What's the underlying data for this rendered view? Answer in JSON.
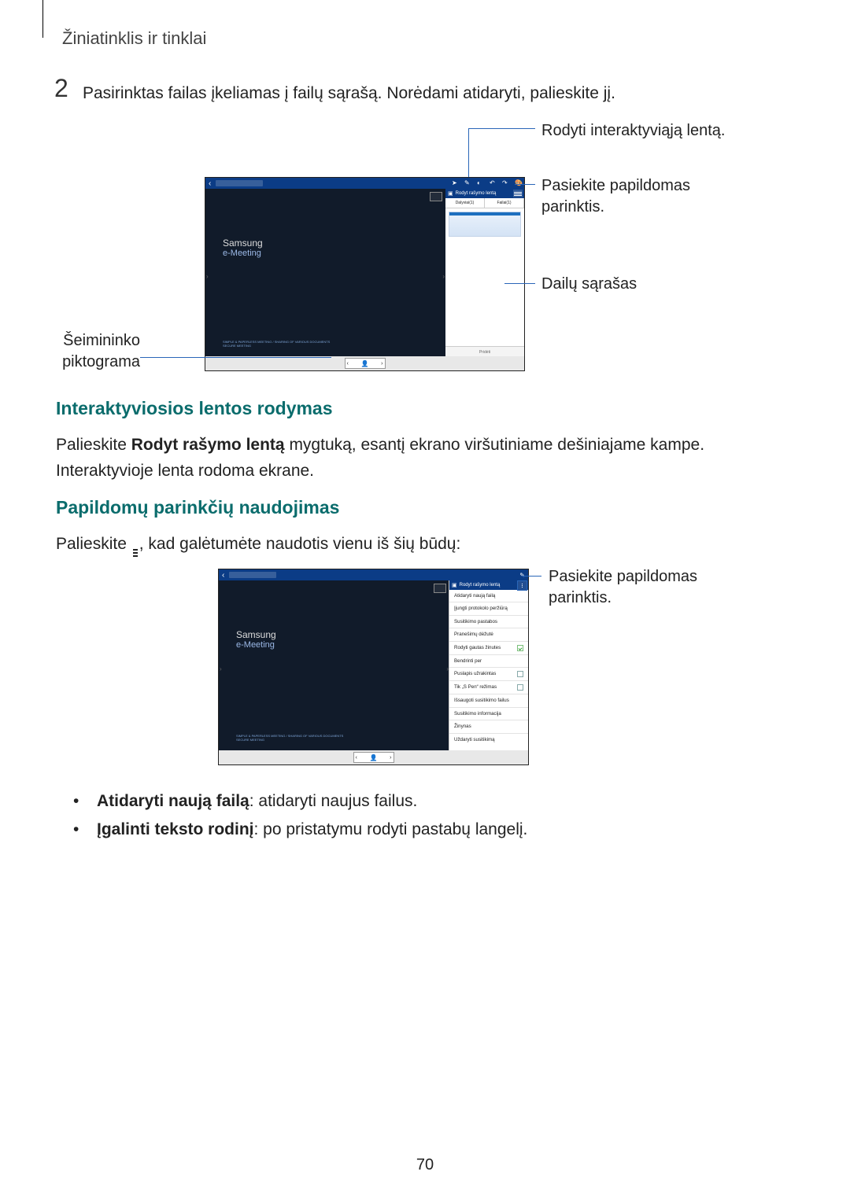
{
  "header": "Žiniatinklis ir tinklai",
  "step": {
    "num": "2",
    "text": "Pasirinktas failas įkeliamas į failų sąrašą. Norėdami atidaryti, palieskite jį."
  },
  "fig1": {
    "show_draw_board": "Rodyt rašymo lentą",
    "brand": {
      "l1": "Samsung",
      "l2": "e-Meeting"
    },
    "foot1": "SIMPLE & PAPERLESS MEETING / SHARING OF VARIOUS DOCUMENTS",
    "foot2": "SECURE MEETING",
    "tabs": {
      "participants": "Dalyviai(1)",
      "files": "Failai(1)"
    },
    "add": "Pridėti",
    "callouts": {
      "top": "Rodyti interaktyviąją lentą.",
      "options": "Pasiekite papildomas parinktis.",
      "filelist": "Dailų sąrašas",
      "owner": "Šeimininko piktograma"
    }
  },
  "section1": {
    "title": "Interaktyviosios lentos rodymas",
    "p1_pre": "Palieskite ",
    "p1_bold": "Rodyt rašymo lentą",
    "p1_post": " mygtuką, esantį ekrano viršutiniame dešiniajame kampe. Interaktyvioje lenta rodoma ekrane."
  },
  "section2": {
    "title": "Papildomų parinkčių naudojimas",
    "p1_pre": "Palieskite ",
    "p1_post": ", kad galėtumėte naudotis vienu iš šių būdų:"
  },
  "fig2": {
    "show_draw_board": "Rodyt rašymo lentą",
    "brand": {
      "l1": "Samsung",
      "l2": "e-Meeting"
    },
    "foot1": "SIMPLE & PAPERLESS MEETING / SHARING OF VARIOUS DOCUMENTS",
    "foot2": "SECURE MEETING",
    "menu": [
      {
        "label": "Atidaryti naują failą",
        "check": null
      },
      {
        "label": "Įjungti protokolo peržiūrą",
        "check": null
      },
      {
        "label": "Susitikimo pastabos",
        "check": null
      },
      {
        "label": "Pranešimų dėžutė",
        "check": null
      },
      {
        "label": "Rodyti gautas žinutes",
        "check": "on"
      },
      {
        "label": "Bendrinti per",
        "check": null
      },
      {
        "label": "Puslapis užrakintas",
        "check": "off"
      },
      {
        "label": "Tik „S Pen“ režimas",
        "check": "off"
      },
      {
        "label": "Išsaugoti susitikimo failus",
        "check": null
      },
      {
        "label": "Susitikimo informacija",
        "check": null
      },
      {
        "label": "Žinynas",
        "check": null
      },
      {
        "label": "Uždaryti susitikimą",
        "check": null
      }
    ],
    "callout": "Pasiekite papildomas parinktis."
  },
  "bullets": [
    {
      "bold": "Atidaryti naują failą",
      "rest": ": atidaryti naujus failus."
    },
    {
      "bold": "Įgalinti teksto rodinį",
      "rest": ": po pristatymu rodyti pastabų langelį."
    }
  ],
  "pagenum": "70"
}
